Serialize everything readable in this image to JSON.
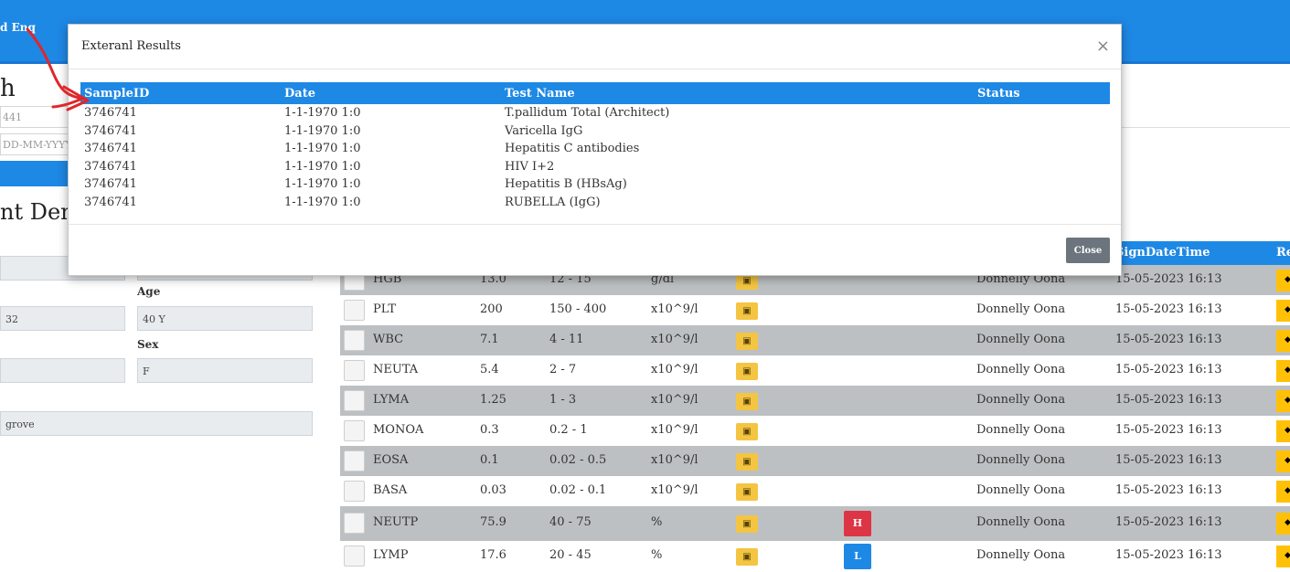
{
  "topbar": {
    "label": "d Enq"
  },
  "background": {
    "heading": "h",
    "field1": "441",
    "date_placeholder": "DD-MM-YYYY",
    "section_title": "nt Demo",
    "age_label": "Age",
    "age_value": "40 Y",
    "dob_fragment": "32",
    "sex_label": "Sex",
    "sex_value": "F",
    "address_fragment": "grove"
  },
  "results_table": {
    "header_sign": "SignDateTime",
    "header_edge": "Re",
    "rows": [
      {
        "test": "HGB",
        "value": "13.0",
        "range": "12 - 15",
        "unit": "g/dl",
        "flag": "",
        "user": "Donnelly Oona",
        "datetime": "15-05-2023 16:13"
      },
      {
        "test": "PLT",
        "value": "200",
        "range": "150 - 400",
        "unit": "x10^9/l",
        "flag": "",
        "user": "Donnelly Oona",
        "datetime": "15-05-2023 16:13"
      },
      {
        "test": "WBC",
        "value": "7.1",
        "range": "4 - 11",
        "unit": "x10^9/l",
        "flag": "",
        "user": "Donnelly Oona",
        "datetime": "15-05-2023 16:13"
      },
      {
        "test": "NEUTA",
        "value": "5.4",
        "range": "2 - 7",
        "unit": "x10^9/l",
        "flag": "",
        "user": "Donnelly Oona",
        "datetime": "15-05-2023 16:13"
      },
      {
        "test": "LYMA",
        "value": "1.25",
        "range": "1 - 3",
        "unit": "x10^9/l",
        "flag": "",
        "user": "Donnelly Oona",
        "datetime": "15-05-2023 16:13"
      },
      {
        "test": "MONOA",
        "value": "0.3",
        "range": "0.2 - 1",
        "unit": "x10^9/l",
        "flag": "",
        "user": "Donnelly Oona",
        "datetime": "15-05-2023 16:13"
      },
      {
        "test": "EOSA",
        "value": "0.1",
        "range": "0.02 - 0.5",
        "unit": "x10^9/l",
        "flag": "",
        "user": "Donnelly Oona",
        "datetime": "15-05-2023 16:13"
      },
      {
        "test": "BASA",
        "value": "0.03",
        "range": "0.02 - 0.1",
        "unit": "x10^9/l",
        "flag": "",
        "user": "Donnelly Oona",
        "datetime": "15-05-2023 16:13"
      },
      {
        "test": "NEUTP",
        "value": "75.9",
        "range": "40 - 75",
        "unit": "%",
        "flag": "H",
        "user": "Donnelly Oona",
        "datetime": "15-05-2023 16:13"
      },
      {
        "test": "LYMP",
        "value": "17.6",
        "range": "20 - 45",
        "unit": "%",
        "flag": "L",
        "user": "Donnelly Oona",
        "datetime": "15-05-2023 16:13"
      }
    ]
  },
  "modal": {
    "title": "Exteranl Results",
    "close_x": "×",
    "columns": [
      "SampleID",
      "Date",
      "Test Name",
      "Status"
    ],
    "rows": [
      {
        "sample_id": "3746741",
        "date": "1-1-1970 1:0",
        "test_name": "T.pallidum Total (Architect)",
        "status": ""
      },
      {
        "sample_id": "3746741",
        "date": "1-1-1970 1:0",
        "test_name": "Varicella IgG",
        "status": ""
      },
      {
        "sample_id": "3746741",
        "date": "1-1-1970 1:0",
        "test_name": "Hepatitis C antibodies",
        "status": ""
      },
      {
        "sample_id": "3746741",
        "date": "1-1-1970 1:0",
        "test_name": "HIV I+2",
        "status": ""
      },
      {
        "sample_id": "3746741",
        "date": "1-1-1970 1:0",
        "test_name": "Hepatitis B (HBsAg)",
        "status": ""
      },
      {
        "sample_id": "3746741",
        "date": "1-1-1970 1:0",
        "test_name": "RUBELLA (IgG)",
        "status": ""
      }
    ],
    "close_button": "Close"
  },
  "colors": {
    "primary": "#1e88e5",
    "row_grey": "#bdc0c2",
    "flag_high": "#dc3545",
    "flag_low": "#1e88e5",
    "action_yellow": "#ffc107",
    "annotation_arrow": "#e0262a"
  },
  "icons": {
    "clip": "clipboard-icon",
    "close": "close-icon",
    "arrow": "annotation-arrow-icon"
  }
}
